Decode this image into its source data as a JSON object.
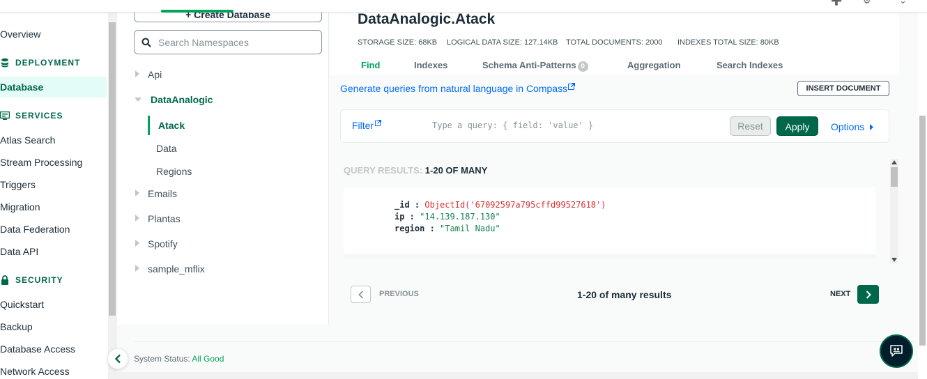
{
  "sidebar": {
    "overview": "Overview",
    "deployment_heading": "DEPLOYMENT",
    "database": "Database",
    "services_heading": "SERVICES",
    "services": [
      "Atlas Search",
      "Stream Processing",
      "Triggers",
      "Migration",
      "Data Federation",
      "Data API"
    ],
    "security_heading": "SECURITY",
    "security": [
      "Quickstart",
      "Backup",
      "Database Access",
      "Network Access"
    ]
  },
  "namespaces": {
    "create_button": "+ Create Database",
    "search_placeholder": "Search Namespaces",
    "databases": [
      "Api",
      "DataAnalogic",
      "Emails",
      "Plantas",
      "Spotify",
      "sample_mflix"
    ],
    "collections": [
      "Atack",
      "Data",
      "Regions"
    ]
  },
  "collection": {
    "title": "DataAnalogic.Atack",
    "stats": {
      "storage": "STORAGE SIZE: 68KB",
      "logical": "LOGICAL DATA SIZE: 127.14KB",
      "documents": "TOTAL DOCUMENTS: 2000",
      "indexes": "INDEXES TOTAL SIZE: 80KB"
    },
    "tabs": [
      "Find",
      "Indexes",
      "Schema Anti-Patterns",
      "Aggregation",
      "Search Indexes"
    ],
    "schema_badge": "0",
    "generate_link": "Generate queries from natural language in Compass",
    "insert_button": "INSERT DOCUMENT",
    "filter_label": "Filter",
    "filter_placeholder": "Type a query: { field: 'value' }",
    "reset_button": "Reset",
    "apply_button": "Apply",
    "options_label": "Options",
    "results_label": "QUERY RESULTS:",
    "results_range": "1-20 OF MANY",
    "document": {
      "id_key": "_id",
      "id_value": "ObjectId('67092597a795cffd99527618')",
      "ip_key": "ip",
      "ip_value": "\"14.139.187.130\"",
      "region_key": "region",
      "region_value": "\"Tamil Nadu\""
    },
    "pagination": {
      "previous": "PREVIOUS",
      "summary": "1-20 of many results",
      "next": "NEXT"
    }
  },
  "footer": {
    "status_label": "System Status:",
    "status_value": "All Good"
  },
  "colors": {
    "accent_green": "#00a35c",
    "dark_green": "#00684a",
    "link_blue": "#016bf8"
  }
}
